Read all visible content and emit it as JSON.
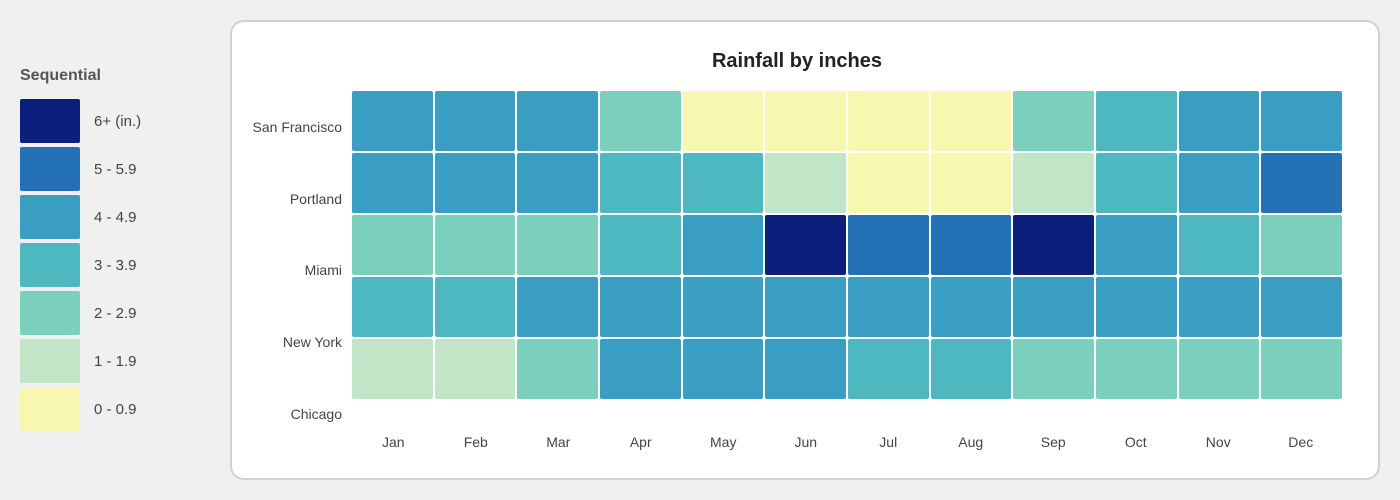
{
  "legend": {
    "title": "Sequential",
    "items": [
      {
        "label": "6+ (in.)",
        "colorClass": "c-6"
      },
      {
        "label": "5 - 5.9",
        "colorClass": "c-5"
      },
      {
        "label": "4 - 4.9",
        "colorClass": "c-4"
      },
      {
        "label": "3 - 3.9",
        "colorClass": "c-3"
      },
      {
        "label": "2 - 2.9",
        "colorClass": "c-2"
      },
      {
        "label": "1 - 1.9",
        "colorClass": "c-1"
      },
      {
        "label": "0 - 0.9",
        "colorClass": "c-0"
      }
    ]
  },
  "chart": {
    "title": "Rainfall by inches",
    "cities": [
      "San Francisco",
      "Portland",
      "Miami",
      "New York",
      "Chicago"
    ],
    "months": [
      "Jan",
      "Feb",
      "Mar",
      "Apr",
      "May",
      "Jun",
      "Jul",
      "Aug",
      "Sep",
      "Oct",
      "Nov",
      "Dec"
    ],
    "data": {
      "San Francisco": [
        "c-4",
        "c-4",
        "c-4",
        "c-2",
        "c-0",
        "c-0",
        "c-0",
        "c-0",
        "c-2",
        "c-3",
        "c-4",
        "c-4"
      ],
      "Portland": [
        "c-4",
        "c-4",
        "c-4",
        "c-3",
        "c-3",
        "c-1",
        "c-0",
        "c-0",
        "c-1",
        "c-3",
        "c-4",
        "c-5"
      ],
      "Miami": [
        "c-2",
        "c-2",
        "c-2",
        "c-3",
        "c-4",
        "c-6",
        "c-5",
        "c-5",
        "c-6",
        "c-4",
        "c-3",
        "c-2"
      ],
      "New York": [
        "c-3",
        "c-3",
        "c-4",
        "c-4",
        "c-4",
        "c-4",
        "c-4",
        "c-4",
        "c-4",
        "c-4",
        "c-4",
        "c-4"
      ],
      "Chicago": [
        "c-1",
        "c-1",
        "c-2",
        "c-4",
        "c-4",
        "c-4",
        "c-3",
        "c-3",
        "c-2",
        "c-2",
        "c-2",
        "c-2"
      ]
    }
  }
}
